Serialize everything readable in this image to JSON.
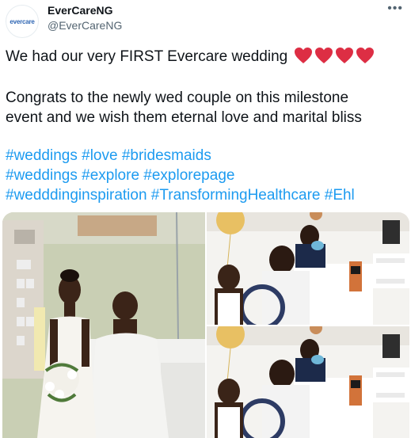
{
  "tweet": {
    "avatar_text": "evercare",
    "author_name": "EverCareNG",
    "author_handle": "@EverCareNG",
    "more_icon": "more-horizontal-icon",
    "line1": "We had our very FIRST Evercare wedding",
    "hearts": [
      "red-heart-emoji",
      "red-heart-emoji",
      "red-heart-emoji",
      "red-heart-emoji"
    ],
    "heart_color": "#dd2e44",
    "line2a": "Congrats to the newly wed couple on this milestone",
    "line2b": "event and we wish them eternal love and marital bliss",
    "hashtag_lines": [
      [
        "#weddings",
        "#love",
        "#bridesmaids"
      ],
      [
        "#weddings",
        "#explore",
        "#explorepage"
      ],
      [
        "#wedddinginspiration",
        "#TransformingHealthcare",
        "#Ehl"
      ]
    ],
    "hashtag_color": "#1d9bf0"
  },
  "media": {
    "photos": [
      {
        "label": "couple-in-hospital-room-photo"
      },
      {
        "label": "wedding-signing-photo-1"
      },
      {
        "label": "wedding-signing-photo-2"
      }
    ]
  }
}
